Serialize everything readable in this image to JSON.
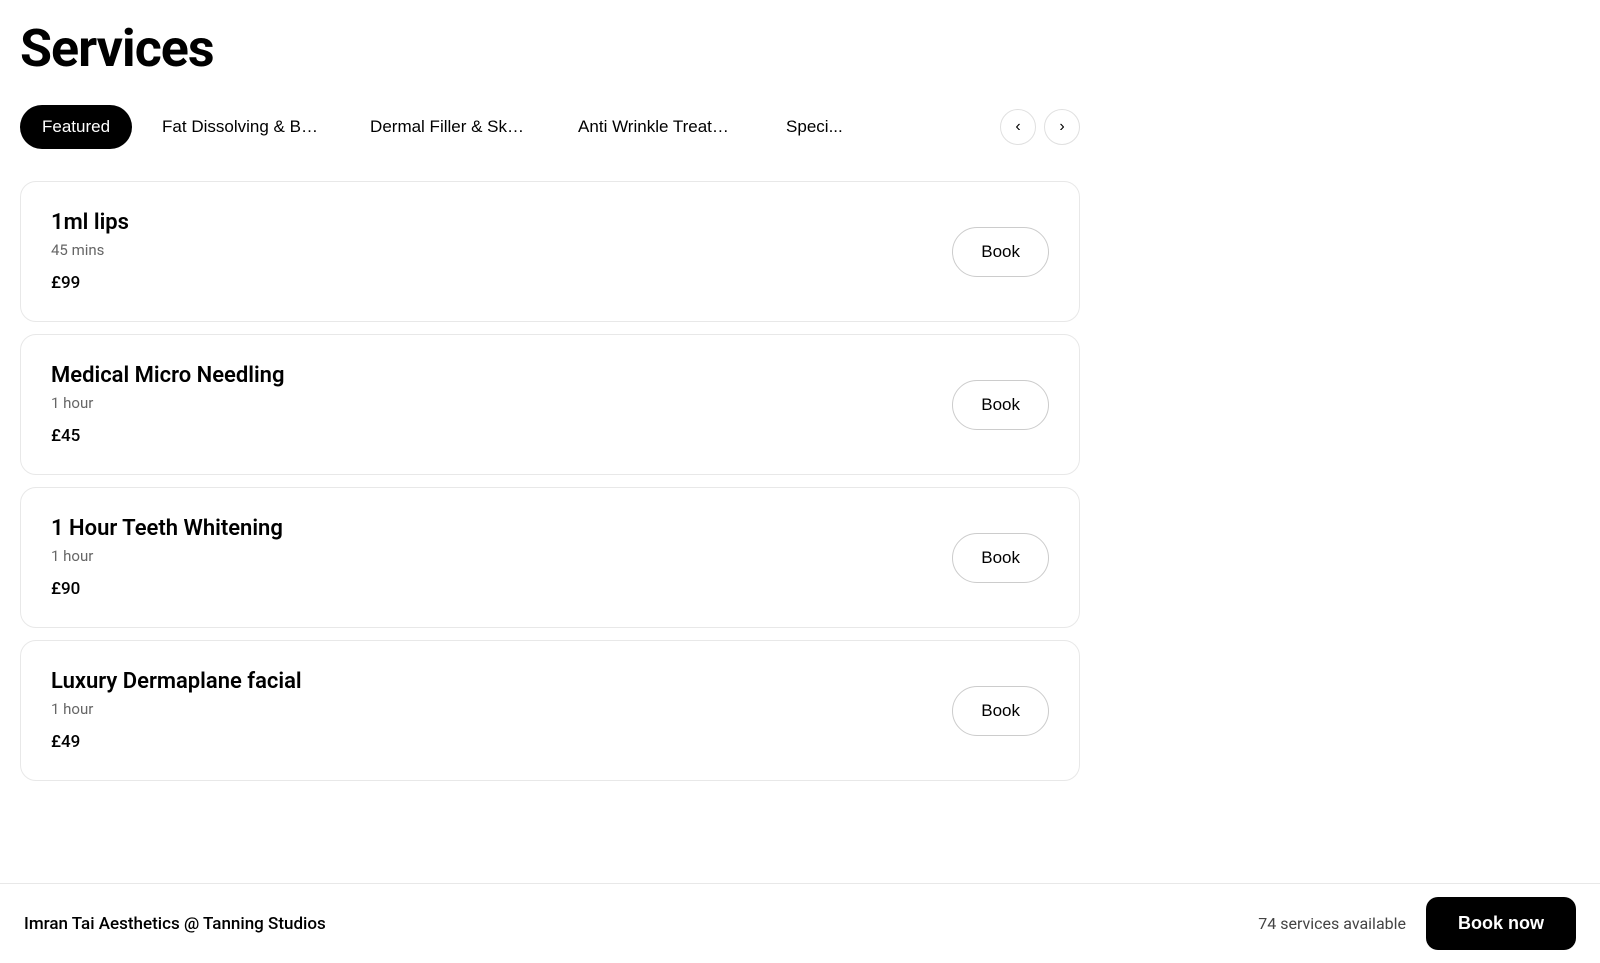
{
  "page": {
    "title": "Services"
  },
  "tabs": {
    "items": [
      {
        "id": "featured",
        "label": "Featured",
        "active": true
      },
      {
        "id": "fat-dissolving",
        "label": "Fat Dissolving & Body Cont...",
        "active": false
      },
      {
        "id": "dermal-filler",
        "label": "Dermal Filler & Skin Boosters",
        "active": false
      },
      {
        "id": "anti-wrinkle",
        "label": "Anti Wrinkle Treatment",
        "active": false
      },
      {
        "id": "special",
        "label": "Speci...",
        "active": false
      }
    ],
    "prev_label": "‹",
    "next_label": "›"
  },
  "services": [
    {
      "id": "1ml-lips",
      "name": "1ml lips",
      "duration": "45 mins",
      "price": "£99",
      "book_label": "Book"
    },
    {
      "id": "medical-micro-needling",
      "name": "Medical Micro Needling",
      "duration": "1 hour",
      "price": "£45",
      "book_label": "Book"
    },
    {
      "id": "1-hour-teeth-whitening",
      "name": "1 Hour Teeth Whitening",
      "duration": "1 hour",
      "price": "£90",
      "book_label": "Book"
    },
    {
      "id": "luxury-dermaplane-facial",
      "name": "Luxury Dermaplane facial",
      "duration": "1 hour",
      "price": "£49",
      "book_label": "Book"
    }
  ],
  "footer": {
    "venue": "Imran Tai Aesthetics @ Tanning Studios",
    "services_count": "74 services available",
    "book_now_label": "Book now"
  }
}
